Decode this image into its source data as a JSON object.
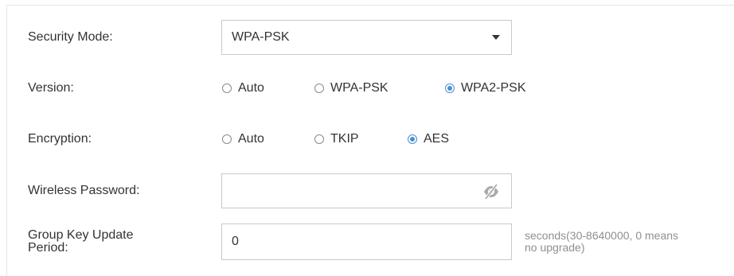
{
  "security_mode": {
    "label": "Security Mode:",
    "selected": "WPA-PSK",
    "dropdown_icon": "caret-down-icon"
  },
  "version": {
    "label": "Version:",
    "options": [
      {
        "label": "Auto",
        "checked": false
      },
      {
        "label": "WPA-PSK",
        "checked": false
      },
      {
        "label": "WPA2-PSK",
        "checked": true
      }
    ]
  },
  "encryption": {
    "label": "Encryption:",
    "options": [
      {
        "label": "Auto",
        "checked": false
      },
      {
        "label": "TKIP",
        "checked": false
      },
      {
        "label": "AES",
        "checked": true
      }
    ]
  },
  "wireless_password": {
    "label": "Wireless Password:",
    "value": "",
    "visibility_icon": "eye-slash-icon"
  },
  "group_key": {
    "label_line1": "Group Key Update",
    "label_line2": "Period:",
    "value": "0",
    "hint_line1": "seconds(30-8640000, 0 means",
    "hint_line2": "no upgrade)"
  },
  "colors": {
    "accent": "#4a8fd6",
    "text": "#333333",
    "hint": "#8f8f8f",
    "border": "#c9c9c9"
  }
}
